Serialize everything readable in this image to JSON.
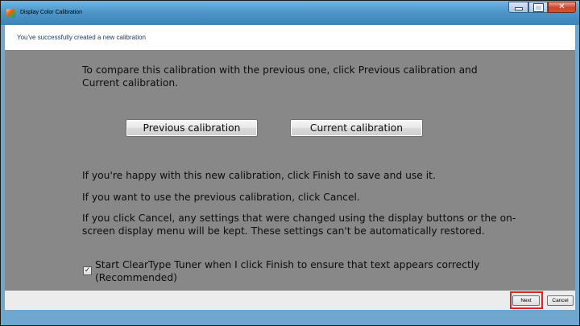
{
  "window": {
    "title": "Display Color Calibration",
    "icon": "color-calibration-icon",
    "controls": [
      "minimize-icon",
      "maximize-icon",
      "close-icon"
    ]
  },
  "header": {
    "text": "You've successfully created a new calibration"
  },
  "content": {
    "intro": "To compare this calibration with the previous one, click Previous calibration and Current calibration.",
    "previous_button": "Previous calibration",
    "current_button": "Current calibration",
    "happy_text": "If you're happy with this new calibration, click Finish to save and use it.",
    "previous_text": "If you want to use the previous calibration, click Cancel.",
    "cancel_text": "If you click Cancel, any settings that were changed using the display buttons or the on-screen display menu will be kept. These settings can't be automatically restored.",
    "cleartype": {
      "checked": true,
      "label": "Start ClearType Tuner when I click Finish to ensure that text appears correctly (Recommended)"
    }
  },
  "footer": {
    "next_label": "Next",
    "cancel_label": "Cancel"
  },
  "colors": {
    "highlight": "#e02424",
    "content_bg": "#888888",
    "header_text": "#1f3b70"
  }
}
